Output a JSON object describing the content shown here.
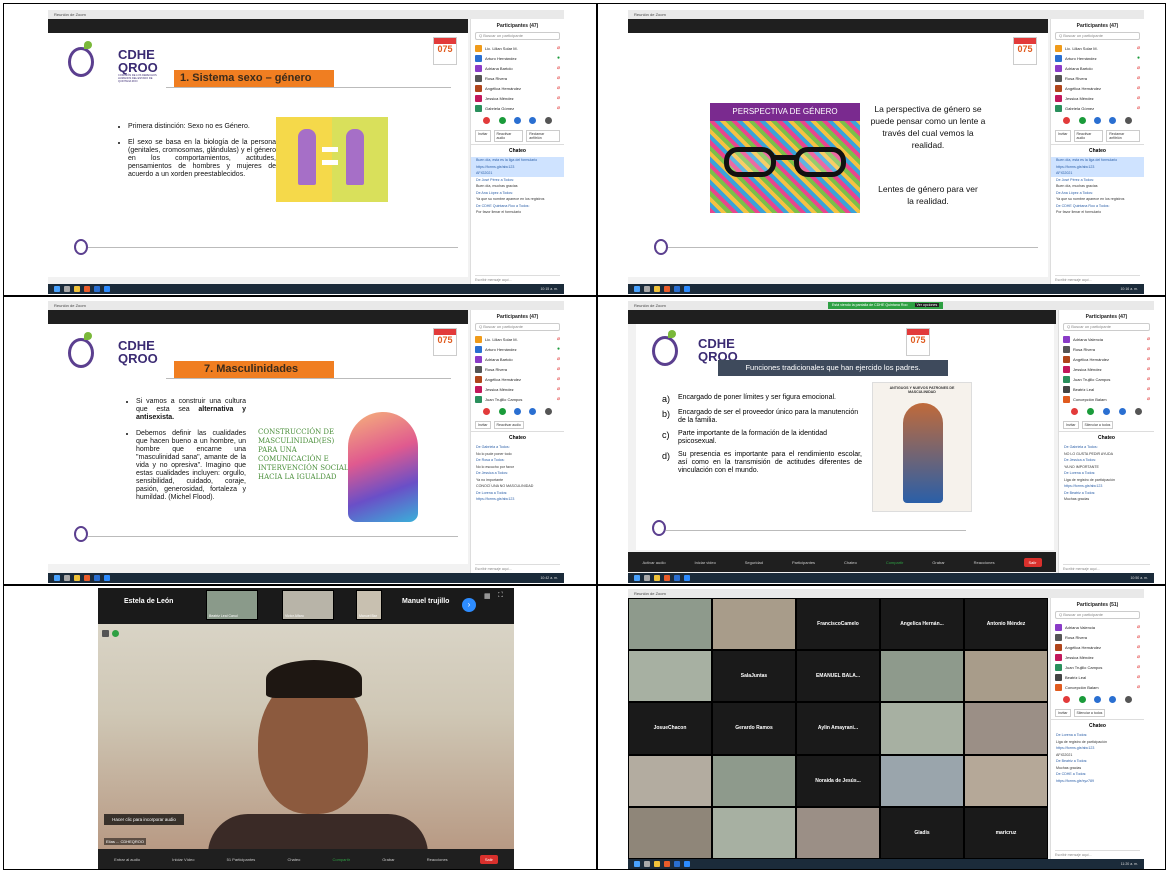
{
  "panel1": {
    "titlebar": "Reunión de Zoom",
    "logo_main": "CDHE",
    "logo_sub": "QROO",
    "logo_caption": "COMISIÓN DE LOS DERECHOS HUMANOS DEL ESTADO DE QUINTANA ROO",
    "slide_title": "1. Sistema sexo – género",
    "bullets": [
      "Primera distinción: Sexo no es Género.",
      "El sexo se basa en la biología de la persona (genitales, cromosomas, glándulas) y el género en los comportamientos, actitudes, pensamientos de hombres y mujeres de acuerdo a un xorden preestablecidos."
    ],
    "sec_logo": "075",
    "participants_header": "Participantes (47)",
    "search_placeholder": "Q Buscar un participante",
    "participants": [
      "Lic. Lilian Solar M.",
      "Arturo Hernández",
      "Adriana Bartolo",
      "Rosa Rivera",
      "Angélica Hernández",
      "Jessica Méndez",
      "Gabriela Gómez"
    ],
    "buttons": [
      "Invitar",
      "Reactivar audio",
      "Reclamar anfitrión"
    ],
    "chat_header": "Chateo",
    "chat_lines": [
      "Buen día, esta es la liga del formulario",
      "https://forms.gle/abc123",
      "AFIG2021",
      "De José Pérez a Todos:",
      "Buen día, muchas gracias",
      "De Ana López a Todos:",
      "Ya que su nombre aparece en los registros",
      "De CDHE Quintana Roo a Todos:",
      "Por favor llenar el formulario"
    ],
    "chat_input": "Escribir mensaje aquí...",
    "time": "10:15 a. m."
  },
  "panel2": {
    "titlebar": "Reunión de Zoom",
    "banner": "PERSPECTIVA DE GÉNERO",
    "text1": "La perspectiva de género se puede pensar como un lente a través del cual vemos la realidad.",
    "text2": "Lentes de género para ver la realidad.",
    "sec_logo": "075",
    "participants_header": "Participantes (47)",
    "search_placeholder": "Q Buscar un participante",
    "participants": [
      "Lic. Lilian Solar M.",
      "Arturo Hernández",
      "Adriana Bartolo",
      "Rosa Rivera",
      "Angélica Hernández",
      "Jessica Méndez",
      "Gabriela Gómez"
    ],
    "buttons": [
      "Invitar",
      "Reactivar audio",
      "Reclamar anfitrión"
    ],
    "chat_header": "Chateo",
    "chat_lines": [
      "Buen día, esta es la liga del formulario",
      "https://forms.gle/abc123",
      "AFIG2021",
      "De José Pérez a Todos:",
      "Buen día, muchas gracias",
      "De Ana López a Todos:",
      "Ya que su nombre aparece en los registros",
      "De CDHE Quintana Roo a Todos:",
      "Por favor llenar el formulario"
    ],
    "chat_input": "Escribir mensaje aquí...",
    "time": "10:16 a. m."
  },
  "panel3": {
    "titlebar": "Reunión de Zoom",
    "logo_main": "CDHE",
    "logo_sub": "QROO",
    "slide_title": "7. Masculinidades",
    "bullet1_a": "Si vamos a construir una cultura que esta sea ",
    "bullet1_b": "alternativa y antisexista.",
    "bullet2": "Debemos definir las cualidades que hacen bueno a un hombre, un hombre que encarne una \"masculinidad sana\", amante de la vida y no opresiva\". Imagino que estas cualidades incluyen: orgullo, sensibilidad, cuidado, coraje, pasión, generosidad, fortaleza y humildad. (Michel Flood).",
    "quote": "CONSTRUCCIÓN DE MASCULINIDAD(ES) PARA UNA COMUNICACIÓN E INTERVENCIÓN SOCIAL HACIA LA IGUALDAD",
    "sec_logo": "075",
    "participants_header": "Participantes (47)",
    "search_placeholder": "Q Buscar un participante",
    "participants": [
      "Lic. Lilian Solar M.",
      "Arturo Hernández",
      "Adriana Bartolo",
      "Rosa Rivera",
      "Angélica Hernández",
      "Jessica Méndez",
      "Juan Trujillo Campos"
    ],
    "buttons": [
      "Invitar",
      "Reactivar audio"
    ],
    "chat_header": "Chateo",
    "chat_lines": [
      "De Gabriela a Todos:",
      "No lo pude poner todo",
      "De Rosa a Todos:",
      "No lo escucho por favor",
      "De Jessica a Todos:",
      "Ya no importante",
      "CONOCÍ UNA NO MASCULINIDAD",
      "De Lorena a Todos:",
      "https://forms.gle/abc123"
    ],
    "chat_input": "Escribir mensaje aquí...",
    "time": "10:42 a. m."
  },
  "panel4": {
    "titlebar": "Reunión de Zoom",
    "share_banner": "Está viendo la pantalla de CDHE Quintana Roo",
    "share_options": "Ver opciones",
    "logo_main": "CDHE",
    "logo_sub": "QROO",
    "slide_title": "Funciones tradicionales que han ejercido los padres.",
    "items": [
      {
        "letter": "a)",
        "text": "Encargado de poner límites y ser figura emocional."
      },
      {
        "letter": "b)",
        "text": "Encargado de ser el proveedor único para la manutención de la familia."
      },
      {
        "letter": "c)",
        "text": "Parte importante de la formación de la identidad psicosexual."
      },
      {
        "letter": "d)",
        "text": "Su presencia es importante para el rendimiento escolar, así como en la transmisión de actitudes diferentes de vinculación con el mundo."
      }
    ],
    "infographic_title": "ANTIGUOS Y NUEVOS PATRONES DE MASCULINIDAD",
    "sec_logo": "075",
    "participants_header": "Participantes (47)",
    "search_placeholder": "Q Buscar un participante",
    "participants": [
      "Adriana Valencia",
      "Rosa Rivera",
      "Angélica Hernández",
      "Jessica Méndez",
      "Juan Trujillo Campos",
      "Beatriz Leal",
      "Concepción Balam"
    ],
    "buttons": [
      "Invitar",
      "Silenciar a todos"
    ],
    "chat_header": "Chateo",
    "chat_lines": [
      "De Gabriela a Todos:",
      "NO LO GUSTA PEDIR AYUDA",
      "De Jessica a Todos:",
      "YA NO IMPORTANTE",
      "De Lorena a Todos:",
      "Liga de registro de participación",
      "https://forms.gle/abc123",
      "De Beatriz a Todos:",
      "Muchas gracias"
    ],
    "chat_input": "Escribir mensaje aquí...",
    "toolbar": [
      "Activar audio",
      "Iniciar video",
      "Seguridad",
      "Participantes",
      "Chateo",
      "Compartir",
      "Grabar",
      "Reacciones"
    ],
    "leave": "Salir",
    "time": "10:50 a. m."
  },
  "panel5": {
    "left_name": "Estela de León",
    "right_name": "Manuel trujillo",
    "thumbs": [
      "Beatriz Leal Canul",
      "Victor Alfaro",
      "Manuel Bar"
    ],
    "hint": "Hacer clic para incorporar audio",
    "speaker": "Elías ... CDHEQROO",
    "toolbar": [
      "Entrar al audio",
      "Iniciar Vídeo",
      "Participantes",
      "Chateo",
      "Compartir",
      "Grabar",
      "Reacciones"
    ],
    "participants_count": "51",
    "leave": "Salir"
  },
  "panel6": {
    "titlebar": "Reunión de Zoom",
    "cells": [
      {
        "name": "",
        "video": true
      },
      {
        "name": "",
        "video": true
      },
      {
        "name": "FranciscoCamelo",
        "video": false
      },
      {
        "name": "Angelica Hernán...",
        "video": false
      },
      {
        "name": "Antonio Méndez",
        "video": false
      },
      {
        "name": "",
        "video": true
      },
      {
        "name": "SalaJuntas",
        "video": false
      },
      {
        "name": "EMANUEL BALA...",
        "video": false
      },
      {
        "name": "",
        "video": true
      },
      {
        "name": "",
        "video": true
      },
      {
        "name": "JosueChacon",
        "video": false
      },
      {
        "name": "Gerardo Ramos",
        "video": false
      },
      {
        "name": "Aylin Amayrani...",
        "video": false
      },
      {
        "name": "",
        "video": true
      },
      {
        "name": "",
        "video": true
      },
      {
        "name": "",
        "video": true
      },
      {
        "name": "",
        "video": true
      },
      {
        "name": "Noraida de Jesús...",
        "video": false
      },
      {
        "name": "",
        "video": true
      },
      {
        "name": "",
        "video": true
      },
      {
        "name": "",
        "video": true
      },
      {
        "name": "",
        "video": true
      },
      {
        "name": "",
        "video": true
      },
      {
        "name": "Gladis",
        "video": false
      },
      {
        "name": "maricruz",
        "video": false
      }
    ],
    "participants_header": "Participantes (51)",
    "search_placeholder": "Q Buscar un participante",
    "participants": [
      "Adriana Valencia",
      "Rosa Rivera",
      "Angélica Hernández",
      "Jessica Méndez",
      "Juan Trujillo Campos",
      "Beatriz Leal",
      "Concepción Balam"
    ],
    "buttons": [
      "Invitar",
      "Silenciar a todos"
    ],
    "chat_header": "Chateo",
    "chat_lines": [
      "De Lorena a Todos:",
      "Liga de registro de participación",
      "https://forms.gle/abc123",
      "AFIG2021",
      "De Beatriz a Todos:",
      "Muchas gracias",
      "De CDHE a Todos:",
      "https://forms.gle/xyz789"
    ],
    "chat_input": "Escribir mensaje aquí...",
    "time": "11:20 a. m."
  }
}
